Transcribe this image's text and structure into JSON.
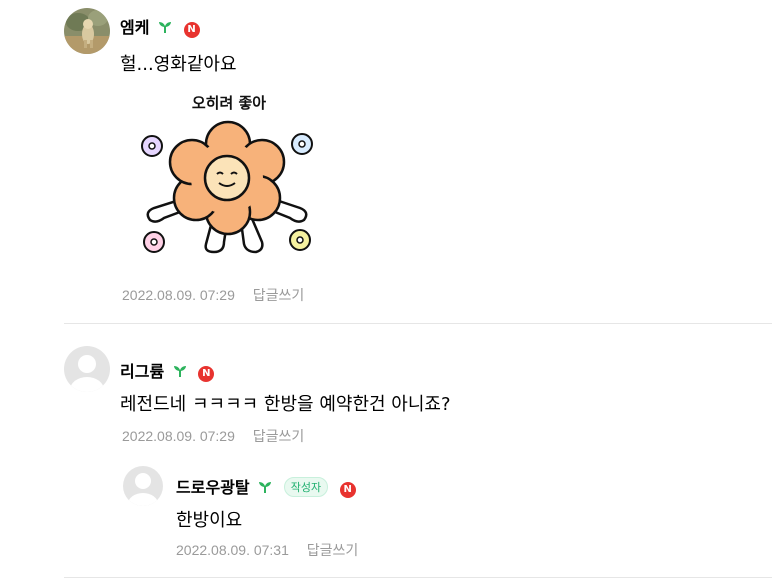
{
  "comments": [
    {
      "nickname": "엠케",
      "level_badge": "N",
      "text": "헐...영화같아요",
      "sticker_caption": "오히려 좋아",
      "date": "2022.08.09. 07:29",
      "reply_label": "답글쓰기"
    },
    {
      "nickname": "리그륨",
      "level_badge": "N",
      "text": "레전드네 ㅋㅋㅋㅋ 한방을 예약한건 아니죠?",
      "date": "2022.08.09. 07:29",
      "reply_label": "답글쓰기"
    },
    {
      "nickname": "드로우광탈",
      "level_badge": "N",
      "author_badge": "작성자",
      "text": "한방이요",
      "date": "2022.08.09. 07:31",
      "reply_label": "답글쓰기"
    }
  ],
  "colors": {
    "leaf_icon": "#2db35d",
    "new_badge": "#e8332f",
    "meta_text": "#9a9a9a",
    "author_badge_text": "#20b070",
    "sticker_flower": "#f7b27a"
  },
  "icons": {
    "leaf": "leaf-icon",
    "new": "new-badge-icon",
    "avatar_default": "default-avatar-icon"
  }
}
